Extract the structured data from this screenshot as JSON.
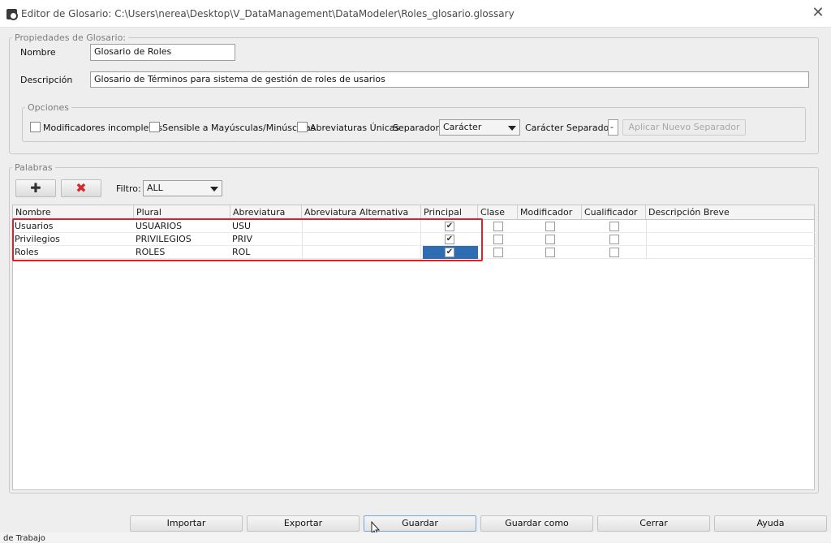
{
  "window": {
    "title": "Editor de Glosario: C:\\Users\\nerea\\Desktop\\V_DataManagement\\DataModeler\\Roles_glosario.glossary"
  },
  "properties": {
    "legend": "Propiedades de Glosario:",
    "name_label": "Nombre",
    "name_value": "Glosario de Roles",
    "desc_label": "Descripción",
    "desc_value": "Glosario de Términos para sistema de gestión de roles de usarios"
  },
  "options": {
    "legend": "Opciones",
    "incomplete_modifiers": "Modificadores incompletos",
    "case_sensitive": "Sensible a Mayúsculas/Minúsculas",
    "unique_abbrev": "Abreviaturas Únicas",
    "separator_label": "Separador:",
    "separator_value": "Carácter",
    "char_separator_label": "Carácter Separador:",
    "char_separator_value": "-",
    "apply_separator": "Aplicar Nuevo Separador"
  },
  "words": {
    "legend": "Palabras",
    "filter_label": "Filtro:",
    "filter_value": "ALL",
    "columns": [
      "Nombre",
      "Plural",
      "Abreviatura",
      "Abreviatura Alternativa",
      "Principal",
      "Clase",
      "Modificador",
      "Cualificador",
      "Descripción Breve"
    ],
    "rows": [
      {
        "nombre": "Usuarios",
        "plural": "USUARIOS",
        "abrev": "USU",
        "alt": "",
        "principal": true,
        "clase": false,
        "modificador": false,
        "cualificador": false,
        "desc": ""
      },
      {
        "nombre": "Privilegios",
        "plural": "PRIVILEGIOS",
        "abrev": "PRIV",
        "alt": "",
        "principal": true,
        "clase": false,
        "modificador": false,
        "cualificador": false,
        "desc": ""
      },
      {
        "nombre": "Roles",
        "plural": "ROLES",
        "abrev": "ROL",
        "alt": "",
        "principal": true,
        "clase": false,
        "modificador": false,
        "cualificador": false,
        "desc": ""
      }
    ]
  },
  "buttons": {
    "importar": "Importar",
    "exportar": "Exportar",
    "guardar": "Guardar",
    "guardar_como": "Guardar como",
    "cerrar": "Cerrar",
    "ayuda": "Ayuda"
  },
  "status": {
    "text": "de Trabajo"
  },
  "colors": {
    "selection": "#2e6db4",
    "highlight": "#e0202a"
  }
}
